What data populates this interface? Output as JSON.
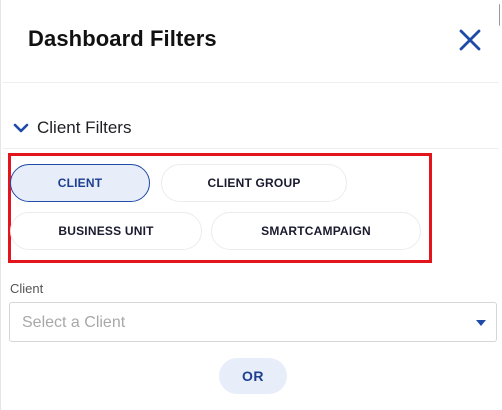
{
  "header": {
    "title": "Dashboard Filters",
    "close_icon": "close-icon"
  },
  "section": {
    "label": "Client Filters",
    "icon": "chevron-down-icon"
  },
  "chips": [
    {
      "label": "CLIENT",
      "selected": true
    },
    {
      "label": "CLIENT GROUP",
      "selected": false
    },
    {
      "label": "BUSINESS UNIT",
      "selected": false
    },
    {
      "label": "SMARTCAMPAIGN",
      "selected": false
    }
  ],
  "client_field": {
    "label": "Client",
    "placeholder": "Select a Client"
  },
  "or_label": "OR",
  "colors": {
    "accent": "#1f4aa8",
    "selected_bg": "#e7eefa",
    "highlight": "#e3141c"
  }
}
